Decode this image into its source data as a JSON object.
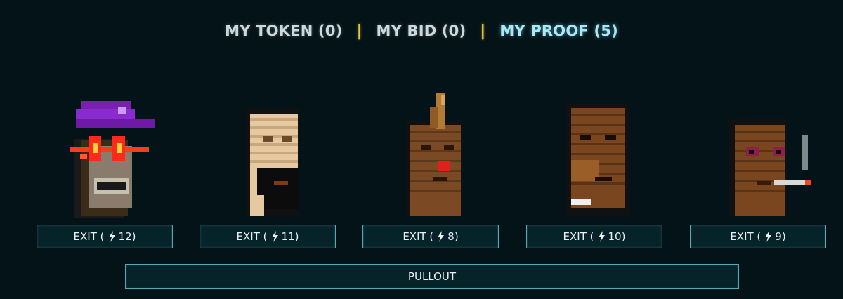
{
  "tabs": [
    {
      "label": "MY TOKEN (0)",
      "active": false
    },
    {
      "label": "MY BID (0)",
      "active": false
    },
    {
      "label": "MY PROOF (5)",
      "active": true
    }
  ],
  "separator": "|",
  "cards": [
    {
      "action_label": "EXIT (",
      "value": "12)",
      "icon": "bolt-icon",
      "avatar": "pixel-ape-purple-hat"
    },
    {
      "action_label": "EXIT (",
      "value": "11)",
      "icon": "bolt-icon",
      "avatar": "pixel-punk-bald"
    },
    {
      "action_label": "EXIT (",
      "value": "8)",
      "icon": "bolt-icon",
      "avatar": "pixel-punk-mohawk"
    },
    {
      "action_label": "EXIT (",
      "value": "10)",
      "icon": "bolt-icon",
      "avatar": "pixel-punk-brown"
    },
    {
      "action_label": "EXIT (",
      "value": "9)",
      "icon": "bolt-icon",
      "avatar": "pixel-punk-cigarette"
    }
  ],
  "pullout_label": "PULLOUT",
  "colors": {
    "background": "#041318",
    "accent": "#a9e8f4",
    "separator": "#e7c739",
    "button_border": "#5aa8b4"
  }
}
